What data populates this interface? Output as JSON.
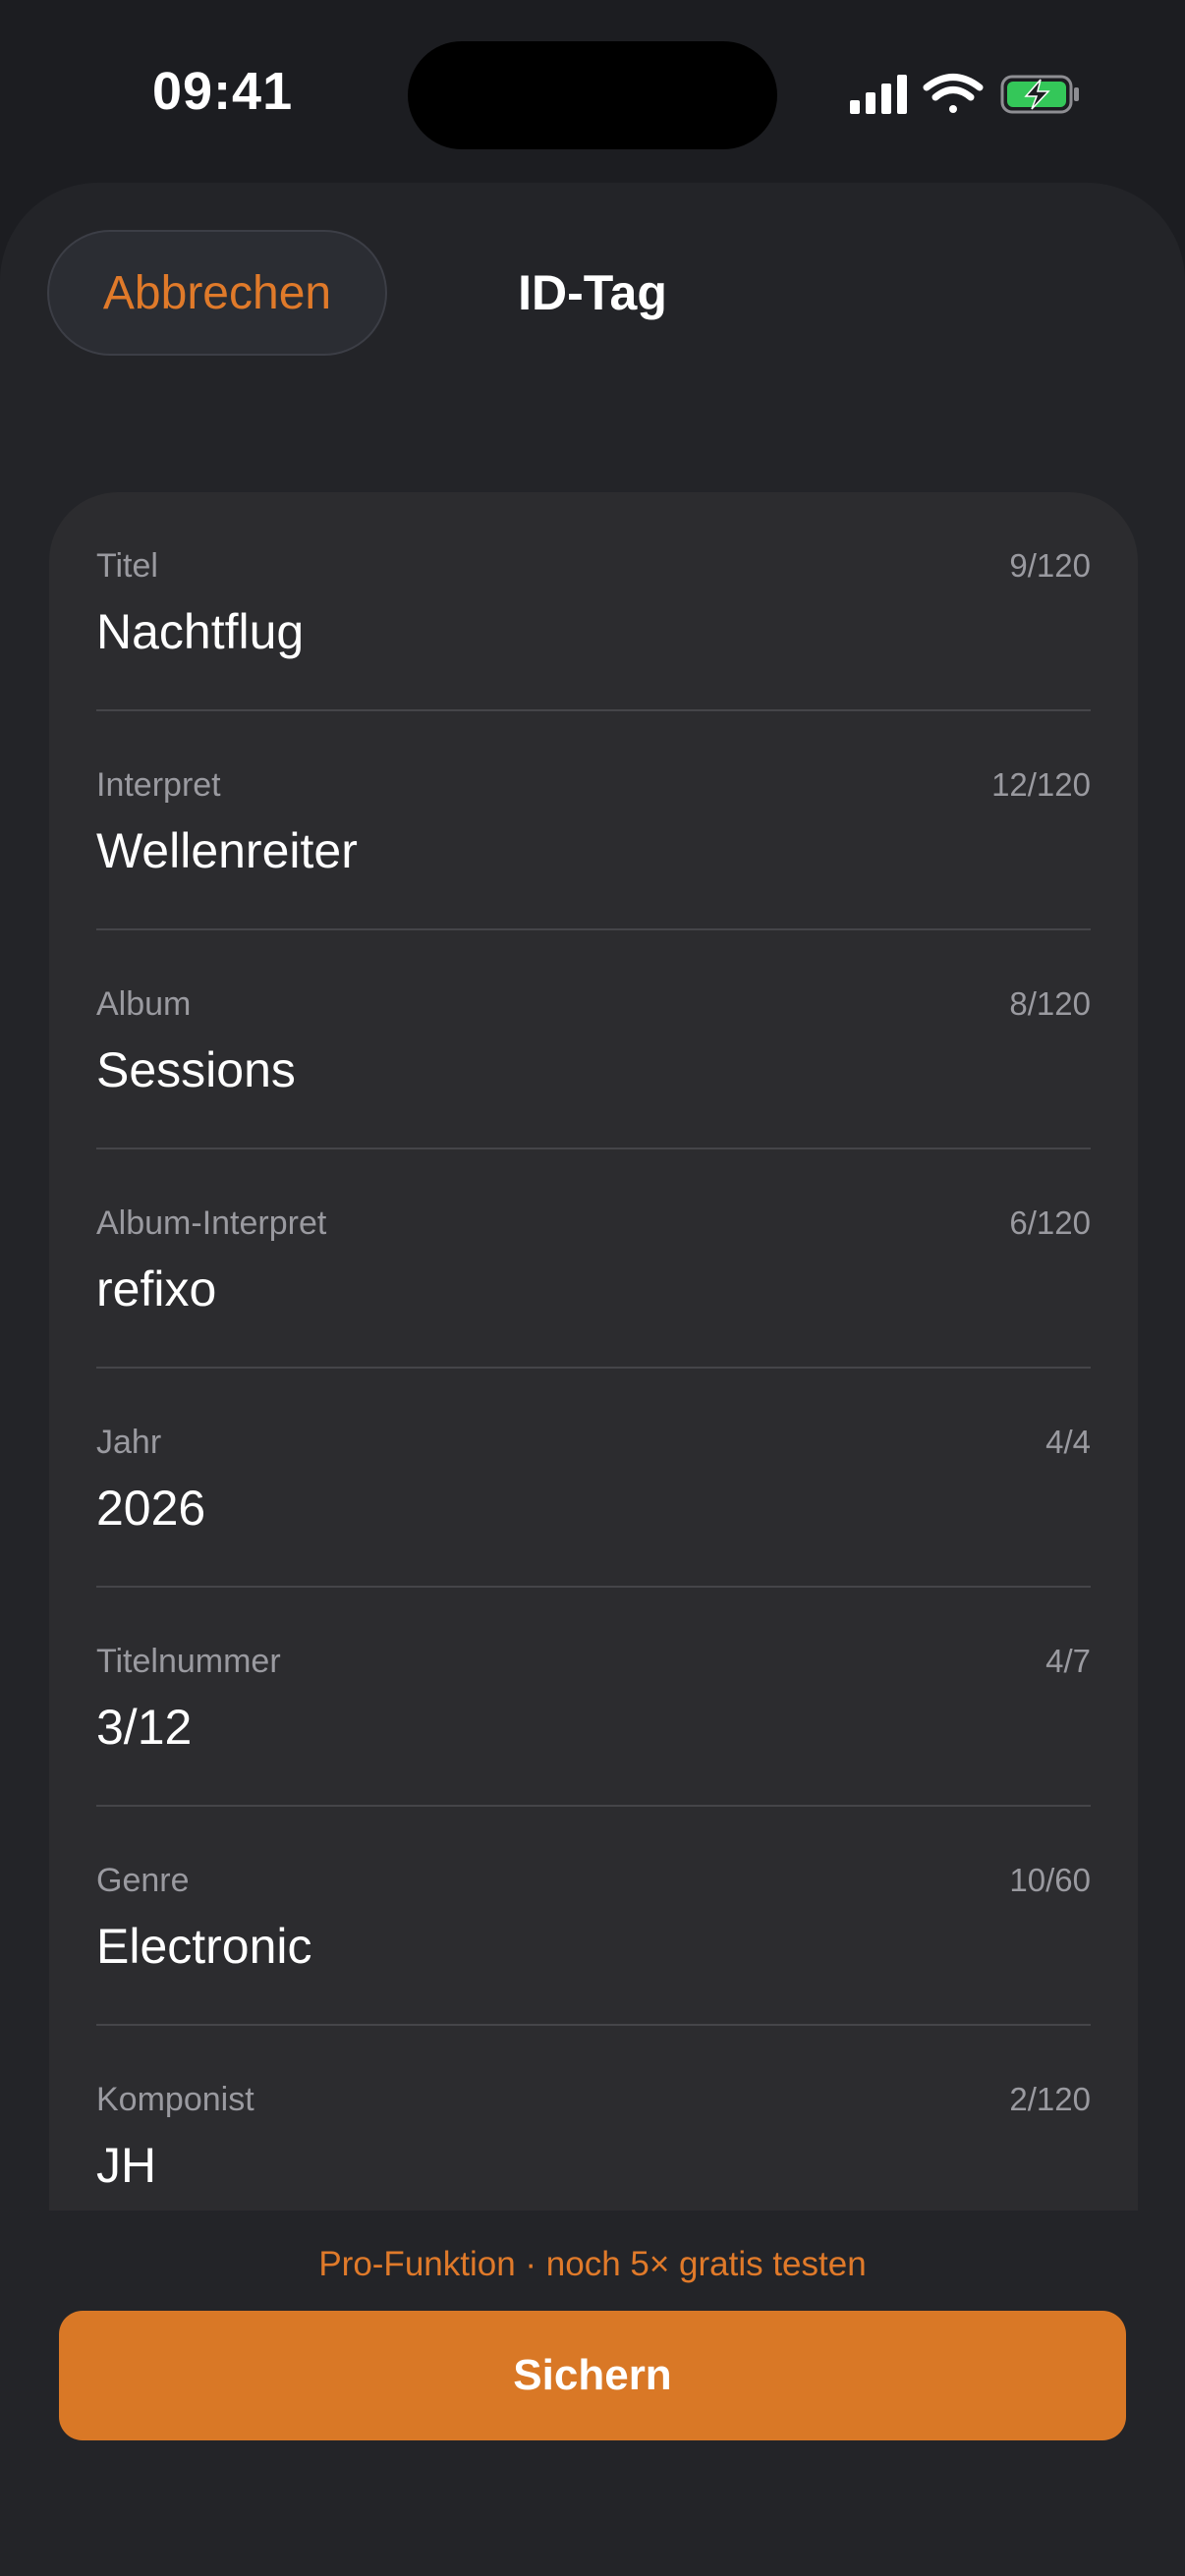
{
  "status_bar": {
    "time": "09:41",
    "icons": [
      "cellular-signal-icon",
      "wifi-icon",
      "battery-charging-icon"
    ]
  },
  "header": {
    "cancel_label": "Abbrechen",
    "title": "ID-Tag"
  },
  "fields": [
    {
      "label": "Titel",
      "value": "Nachtflug",
      "counter": "9/120"
    },
    {
      "label": "Interpret",
      "value": "Wellenreiter",
      "counter": "12/120"
    },
    {
      "label": "Album",
      "value": "Sessions",
      "counter": "8/120"
    },
    {
      "label": "Album-Interpret",
      "value": "refixo",
      "counter": "6/120"
    },
    {
      "label": "Jahr",
      "value": "2026",
      "counter": "4/4"
    },
    {
      "label": "Titelnummer",
      "value": "3/12",
      "counter": "4/7"
    },
    {
      "label": "Genre",
      "value": "Electronic",
      "counter": "10/60"
    },
    {
      "label": "Komponist",
      "value": "JH",
      "counter": "2/120"
    }
  ],
  "footer": {
    "promo_text": "Pro-Funktion · noch 5× gratis testen",
    "save_label": "Sichern"
  },
  "colors": {
    "accent": "#e07a2a",
    "save_button": "#d97826",
    "background": "#1c1d21",
    "sheet": "#232428",
    "card": "#2c2c2f",
    "battery_fill": "#34c759"
  }
}
